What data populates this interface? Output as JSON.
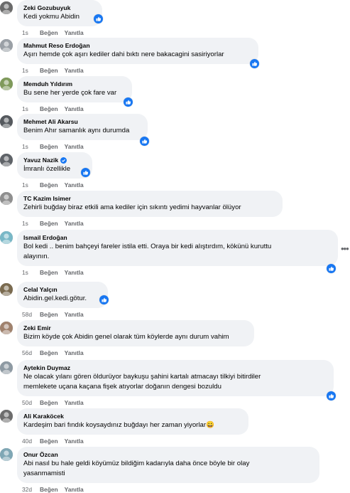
{
  "comments": [
    {
      "name": "Zeki Gozubuyuk",
      "text": [
        "Kedi yokmu Abidin"
      ],
      "time": "1s",
      "avatar": "#6b6b6b",
      "verified": false
    },
    {
      "name": "Mahmut Reso Erdoğan",
      "text": [
        "Aşırı hemde çok aşırı kediler dahi bıktı nere bakacagini sasiriyorlar"
      ],
      "time": "1s",
      "avatar": "#9aa0a6",
      "verified": false
    },
    {
      "name": "Memduh Yıldırım",
      "text": [
        "Bu sene her yerde çok fare var"
      ],
      "time": "1s",
      "avatar": "#7f9a5b",
      "verified": false
    },
    {
      "name": "Mehmet Ali Akarsu",
      "text": [
        "Benim Ahır samanlık aynı durumda"
      ],
      "time": "1s",
      "avatar": "#55595e",
      "verified": false
    },
    {
      "name": "Yavuz Nazik",
      "text": [
        "İmranlı özellikle"
      ],
      "time": "1s",
      "avatar": "#5f6368",
      "verified": true
    },
    {
      "name": "TC Kazim Isimer",
      "text": [
        "Zehirli buğday biraz etkili ama kediler için sıkıntı yedimi hayvanlar ölüyor"
      ],
      "time": "1s",
      "avatar": "#8f8f8f",
      "verified": false
    },
    {
      "name": "Ismail Erdoğan",
      "text": [
        "Bol kedi .. benim bahçeyi fareler istila etti. Oraya bir kedi alıştırdım, kökünü kuruttu",
        "alayının."
      ],
      "time": "1s",
      "avatar": "#79b8c7",
      "verified": false
    },
    {
      "name": "Celal Yalçın",
      "text": [
        "Abidin.gel.kedi.götur."
      ],
      "time": "58d",
      "avatar": "#7a6a4f",
      "verified": false
    },
    {
      "name": "Zeki Emir",
      "text": [
        "Bizim köyde çok Abidin genel olarak tüm köylerde aynı durum vahim"
      ],
      "time": "56d",
      "avatar": "#a0826d",
      "verified": false
    },
    {
      "name": "Aytekin Duymaz",
      "text": [
        "Ne olacak yılanı gören öldurüyor baykuşu şahini kartalı atmacayı tilkiyi bitirdiler",
        "memlekete uçana kaçana fişek atıyorlar doğanın dengesi bozuldu"
      ],
      "time": "50d",
      "avatar": "#8e9aa3",
      "verified": false
    },
    {
      "name": "Ali Karaköcek",
      "text": [
        "Kardeşim bari fındık koysaydınız buğdayı her zaman yiyorlar😀"
      ],
      "time": "40d",
      "avatar": "#6d6d6d",
      "verified": false
    },
    {
      "name": "Onur Özcan",
      "text": [
        "Abi nasıl bu hale geldi köyümüz bildiğim kadarıyla daha önce böyle bir olay",
        "yasanmamisti"
      ],
      "time": "32d",
      "avatar": "#7fa7b5",
      "verified": false
    }
  ],
  "actions": {
    "like": "Beğen",
    "reply": "Yanıtla"
  },
  "icons": {
    "like": "thumbs-up-icon",
    "verified": "verified-badge-icon",
    "more": "more-options-icon"
  },
  "colors": {
    "bubble": "#f0f2f5",
    "like_blue": "#1877f2",
    "meta_gray": "#65676b"
  }
}
